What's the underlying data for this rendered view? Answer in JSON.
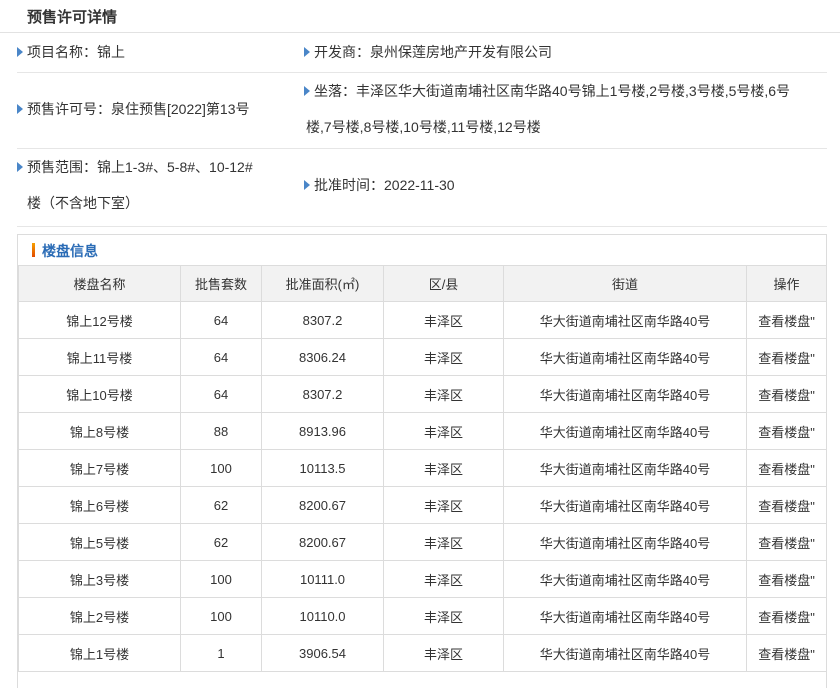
{
  "page_title": "预售许可详情",
  "info": {
    "project_name": "项目名称：锦上",
    "developer": "开发商：泉州保莲房地产开发有限公司",
    "permit_no": "预售许可号：泉住预售[2022]第13号",
    "location_line1": "坐落：丰泽区华大街道南埔社区南华路40号锦上1号楼,2号楼,3号楼,5号楼,6号",
    "location_line2": "楼,7号楼,8号楼,10号楼,11号楼,12号楼",
    "scope_line1": "预售范围：锦上1-3#、5-8#、10-12#",
    "scope_line2": "楼（不含地下室）",
    "approval_time": "批准时间：2022-11-30"
  },
  "section": {
    "title": "楼盘信息"
  },
  "table": {
    "headers": [
      "楼盘名称",
      "批售套数",
      "批准面积(㎡)",
      "区/县",
      "街道",
      "操作"
    ],
    "rows": [
      [
        "锦上12号楼",
        "64",
        "8307.2",
        "丰泽区",
        "华大街道南埔社区南华路40号",
        "查看楼盘\""
      ],
      [
        "锦上11号楼",
        "64",
        "8306.24",
        "丰泽区",
        "华大街道南埔社区南华路40号",
        "查看楼盘\""
      ],
      [
        "锦上10号楼",
        "64",
        "8307.2",
        "丰泽区",
        "华大街道南埔社区南华路40号",
        "查看楼盘\""
      ],
      [
        "锦上8号楼",
        "88",
        "8913.96",
        "丰泽区",
        "华大街道南埔社区南华路40号",
        "查看楼盘\""
      ],
      [
        "锦上7号楼",
        "100",
        "10113.5",
        "丰泽区",
        "华大街道南埔社区南华路40号",
        "查看楼盘\""
      ],
      [
        "锦上6号楼",
        "62",
        "8200.67",
        "丰泽区",
        "华大街道南埔社区南华路40号",
        "查看楼盘\""
      ],
      [
        "锦上5号楼",
        "62",
        "8200.67",
        "丰泽区",
        "华大街道南埔社区南华路40号",
        "查看楼盘\""
      ],
      [
        "锦上3号楼",
        "100",
        "10111.0",
        "丰泽区",
        "华大街道南埔社区南华路40号",
        "查看楼盘\""
      ],
      [
        "锦上2号楼",
        "100",
        "10110.0",
        "丰泽区",
        "华大街道南埔社区南华路40号",
        "查看楼盘\""
      ],
      [
        "锦上1号楼",
        "1",
        "3906.54",
        "丰泽区",
        "华大街道南埔社区南华路40号",
        "查看楼盘\""
      ]
    ]
  }
}
